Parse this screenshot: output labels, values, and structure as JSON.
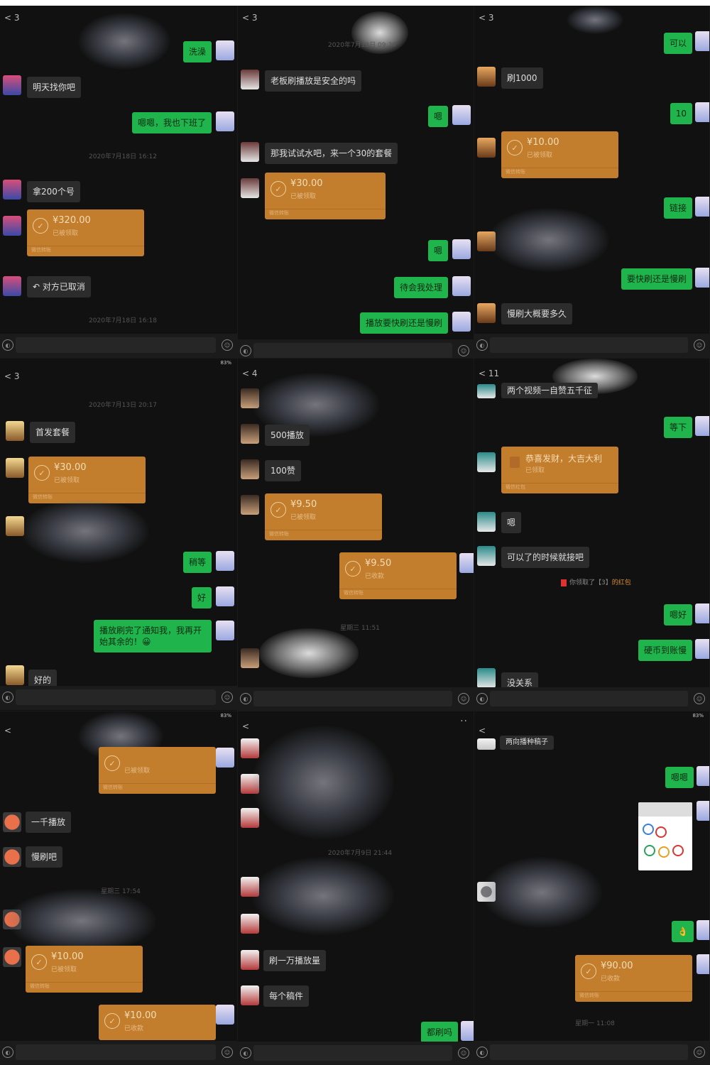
{
  "colors": {
    "incoming_bubble": "#2c2c2c",
    "outgoing_bubble": "#1fb54c",
    "transfer_card": "#c27e2c",
    "background": "#111111"
  },
  "panes": [
    {
      "back": "3",
      "msgs": {
        "m1": "洗澡",
        "m2": "明天找你吧",
        "m3": "嗯嗯，我也下班了",
        "t1": "2020年7月18日 16:12",
        "m4": "拿200个号",
        "tr1_amount": "¥320.00",
        "tr1_status": "已被领取",
        "tr1_footer": "微信转账",
        "m5": "对方已取消",
        "t2": "2020年7月18日 16:18"
      }
    },
    {
      "back": "3",
      "msgs": {
        "t1": "2020年7月12日 09:20",
        "m1": "老板刷播放是安全的吗",
        "m2": "嗯",
        "m3": "那我试试水吧，来一个30的套餐",
        "tr1_amount": "¥30.00",
        "tr1_status": "已被领取",
        "tr1_footer": "微信转账",
        "m4": "嗯",
        "m5": "待会我处理",
        "m6": "播放要快刷还是慢刷"
      }
    },
    {
      "back": "3",
      "msgs": {
        "m1": "可以",
        "m2": "刷1000",
        "m3": "10",
        "tr1_amount": "¥10.00",
        "tr1_status": "已被领取",
        "tr1_footer": "微信转账",
        "m4": "链接",
        "m5": "要快刷还是慢刷",
        "m6": "慢刷大概要多久"
      }
    },
    {
      "back": "3",
      "status": "83%",
      "msgs": {
        "t1": "2020年7月13日 20:17",
        "m1": "首发套餐",
        "tr1_amount": "¥30.00",
        "tr1_status": "已被领取",
        "tr1_footer": "微信转账",
        "m2": "稍等",
        "m3": "好",
        "m4": "播放刷完了通知我，我再开始其余的！😀",
        "m5": "好的"
      }
    },
    {
      "back": "4",
      "msgs": {
        "m1": "500播放",
        "m2": "100赞",
        "tr1_amount": "¥9.50",
        "tr1_status": "已被领取",
        "tr1_footer": "微信转账",
        "tr2_amount": "¥9.50",
        "tr2_status": "已收款",
        "tr2_footer": "微信转账",
        "t1": "星期三 11:51"
      }
    },
    {
      "back": "11",
      "msgs": {
        "m0": "两个视频一自赞五千征",
        "m1": "等下",
        "rp_title": "恭喜发财，大吉大利",
        "rp_status": "已领取",
        "rp_footer": "微信红包",
        "m2": "嗯",
        "m3": "可以了的时候就接吧",
        "note_pre": "你领取了【3】",
        "note_hl": "的红包",
        "m4": "嗯好",
        "m5": "硬币到账慢",
        "m6": "没关系"
      }
    },
    {
      "back": "",
      "status": "83%",
      "msgs": {
        "tr0_status": "已被领取",
        "tr0_footer": "微信转账",
        "m1": "一千播放",
        "m2": "慢刷吧",
        "t1": "星期三 17:54",
        "tr1_amount": "¥10.00",
        "tr1_status": "已被领取",
        "tr1_footer": "微信转账",
        "tr2_amount": "¥10.00",
        "tr2_status": "已收款"
      }
    },
    {
      "back": "",
      "msgs": {
        "t1": "2020年7月9日 21:44",
        "m1": "刷一万播放量",
        "m2": "每个稿件",
        "m3": "都刷吗"
      }
    },
    {
      "back": "",
      "status": "83%",
      "msgs": {
        "m0": "两向播种稿子",
        "m1": "嗯嗯",
        "m2": "👌",
        "tr1_amount": "¥90.00",
        "tr1_status": "已收款",
        "tr1_footer": "微信转账",
        "t1": "星期一 11:08"
      }
    }
  ]
}
